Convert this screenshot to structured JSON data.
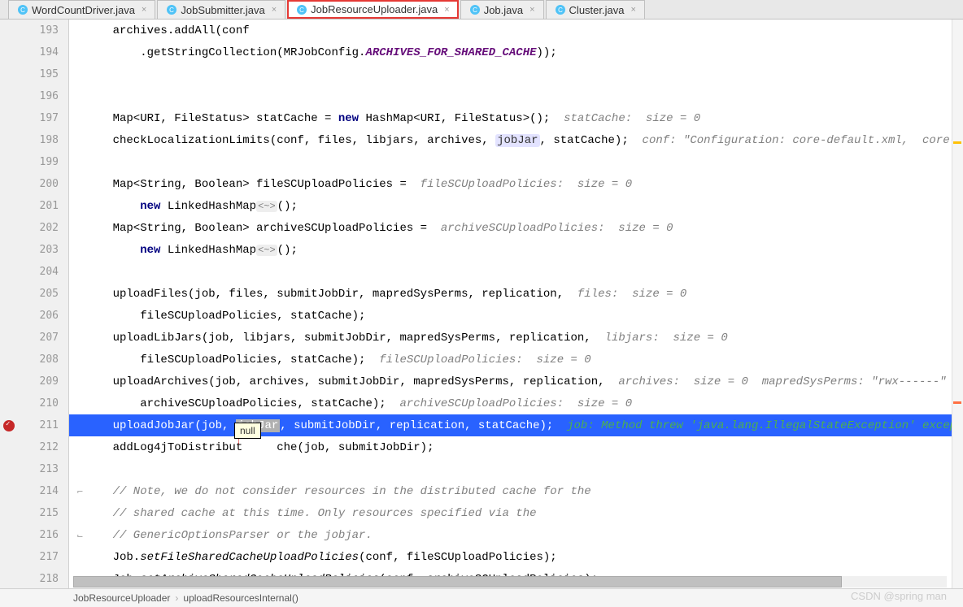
{
  "tabs": [
    {
      "label": "WordCountDriver.java",
      "icon": "c",
      "active": false
    },
    {
      "label": "JobSubmitter.java",
      "icon": "ca",
      "active": false
    },
    {
      "label": "JobResourceUploader.java",
      "icon": "ca",
      "active": true
    },
    {
      "label": "Job.java",
      "icon": "ca",
      "active": false
    },
    {
      "label": "Cluster.java",
      "icon": "ca",
      "active": false
    }
  ],
  "gutter": {
    "start": 193,
    "end": 218,
    "breakpoint_line": 211,
    "bulb_line": 211,
    "fold_start": 214,
    "fold_end": 216
  },
  "code": {
    "l193": "    archives.addAll(conf",
    "l194": "        .getStringCollection(MRJobConfig.",
    "l194_const": "ARCHIVES_FOR_SHARED_CACHE",
    "l194_end": "));",
    "l197_a": "    Map<URI, FileStatus> statCache = ",
    "l197_kw": "new",
    "l197_b": " HashMap<URI, FileStatus>();  ",
    "l197_hint": "statCache:  size = 0",
    "l198_a": "    checkLocalizationLimits(conf, files, libjars, archives, ",
    "l198_hl": "jobJar",
    "l198_b": ", statCache);  ",
    "l198_hint": "conf: \"Configuration: core-default.xml,  core-sit",
    "l200_a": "    Map<String, Boolean> fileSCUploadPolicies =  ",
    "l200_hint": "fileSCUploadPolicies:  size = 0",
    "l201_kw": "new",
    "l201_a": " LinkedHashMap",
    "l201_d": "<~>",
    "l201_b": "();",
    "l202_a": "    Map<String, Boolean> archiveSCUploadPolicies =  ",
    "l202_hint": "archiveSCUploadPolicies:  size = 0",
    "l203_kw": "new",
    "l203_a": " LinkedHashMap",
    "l203_d": "<~>",
    "l203_b": "();",
    "l205_a": "    uploadFiles(job, files, submitJobDir, mapredSysPerms, replication,  ",
    "l205_hint": "files:  size = 0",
    "l206_a": "        fileSCUploadPolicies, statCache);",
    "l207_a": "    uploadLibJars(job, libjars, submitJobDir, mapredSysPerms, replication,  ",
    "l207_hint": "libjars:  size = 0",
    "l208_a": "        fileSCUploadPolicies, statCache);  ",
    "l208_hint": "fileSCUploadPolicies:  size = 0",
    "l209_a": "    uploadArchives(job, archives, submitJobDir, mapredSysPerms, replication,  ",
    "l209_hint": "archives:  size = 0  mapredSysPerms: \"rwx------\"",
    "l210_a": "        archiveSCUploadPolicies, statCache);  ",
    "l210_hint": "archiveSCUploadPolicies:  size = 0",
    "l211_a": "    uploadJobJar(job, ",
    "l211_hl": "jobJar",
    "l211_b": ", submitJobDir, replication, statCache);  ",
    "l211_hint": "job: Method threw 'java.lang.IllegalStateException' excepti",
    "l212_a": "    addLog4jToDistribut     che(job, submitJobDir);",
    "l214_c": "    // Note, we do not consider resources in the distributed cache for the",
    "l215_c": "    // shared cache at this time. Only resources specified via the",
    "l216_c": "    // GenericOptionsParser or the jobjar.",
    "l217_a": "    Job.",
    "l217_m": "setFileSharedCacheUploadPolicies",
    "l217_b": "(conf, fileSCUploadPolicies);",
    "l218_a": "    Job.",
    "l218_m": "setArchiveSharedCacheUploadPolicies",
    "l218_b": "(conf, archiveSCUploadPolicies);"
  },
  "tooltip": "null",
  "breadcrumb": {
    "class": "JobResourceUploader",
    "method": "uploadResourcesInternal()"
  },
  "watermark": "CSDN @spring man"
}
